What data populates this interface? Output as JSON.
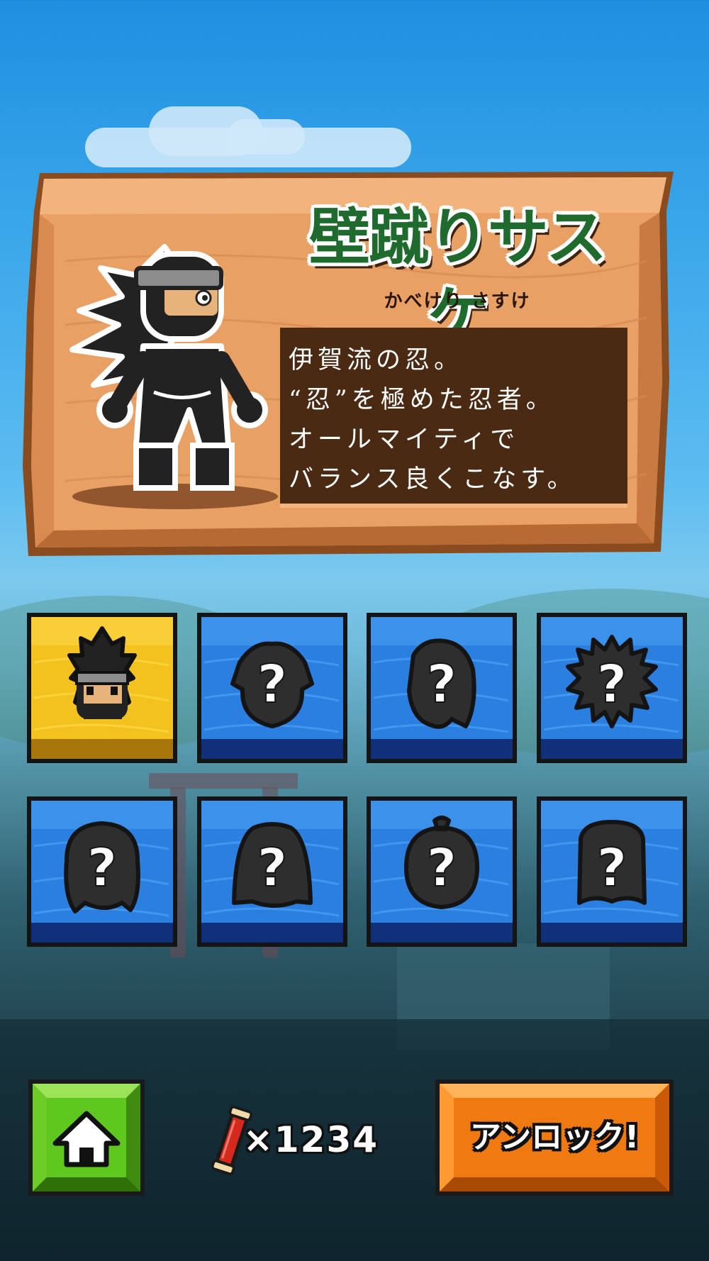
{
  "character": {
    "name": "壁蹴りサスケ",
    "reading": "かべけり さすけ",
    "description": [
      "伊賀流の忍。",
      "“忍”を極めた忍者。",
      "オールマイティで",
      "バランス良くこなす。"
    ]
  },
  "grid": {
    "tiles": [
      {
        "state": "selected",
        "icon": "ninja-sasuke-face-icon"
      },
      {
        "state": "locked",
        "mark": "?",
        "icon": "mystery-silhouette-icon"
      },
      {
        "state": "locked",
        "mark": "?",
        "icon": "mystery-silhouette-icon"
      },
      {
        "state": "locked",
        "mark": "?",
        "icon": "mystery-silhouette-icon"
      },
      {
        "state": "locked",
        "mark": "?",
        "icon": "mystery-silhouette-icon"
      },
      {
        "state": "locked",
        "mark": "?",
        "icon": "mystery-silhouette-icon"
      },
      {
        "state": "locked",
        "mark": "?",
        "icon": "mystery-silhouette-icon"
      },
      {
        "state": "locked",
        "mark": "?",
        "icon": "mystery-silhouette-icon"
      }
    ]
  },
  "footer": {
    "home_icon": "home-icon",
    "scroll_count": "×1234",
    "unlock_label": "アンロック!"
  },
  "colors": {
    "sky": "#3aa6ea",
    "wood": "#e9a064",
    "selected_tile": "#f3c21e",
    "locked_tile": "#2a7fe0",
    "home_button": "#5fc81e",
    "unlock_button": "#f07a12",
    "name_text": "#1f6b2e"
  }
}
